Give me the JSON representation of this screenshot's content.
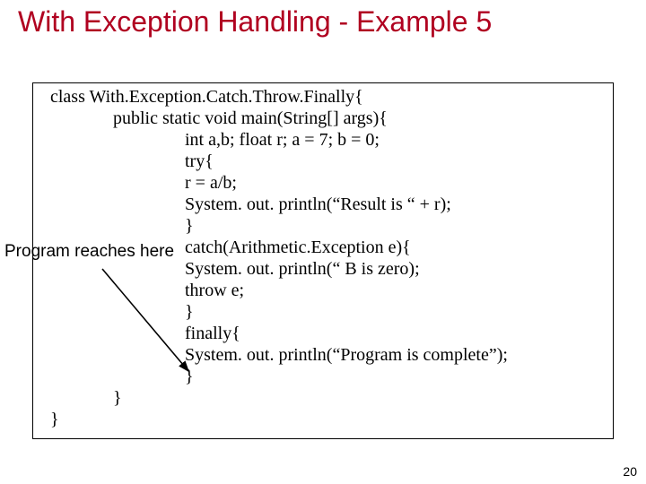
{
  "title": "With Exception Handling  - Example 5",
  "annotation": "Program reaches here",
  "page_number": "20",
  "code": {
    "l0": "class With.Exception.Catch.Throw.Finally{",
    "l1": "public static void main(String[] args){",
    "l2": "int a,b;  float r;  a = 7;   b = 0;",
    "l3": "try{",
    "l4": "   r = a/b;",
    "l5": "   System. out. println(“Result is “ + r);",
    "l6": " }",
    "l7": " catch(Arithmetic.Exception e){",
    "l8": "      System. out. println(“ B is zero);",
    "l9": "      throw e;",
    "l10": " }",
    "l11": " finally{",
    "l12": "  System. out. println(“Program is complete”);",
    "l13": "  }",
    "l14": "  }",
    "l15": "}"
  }
}
